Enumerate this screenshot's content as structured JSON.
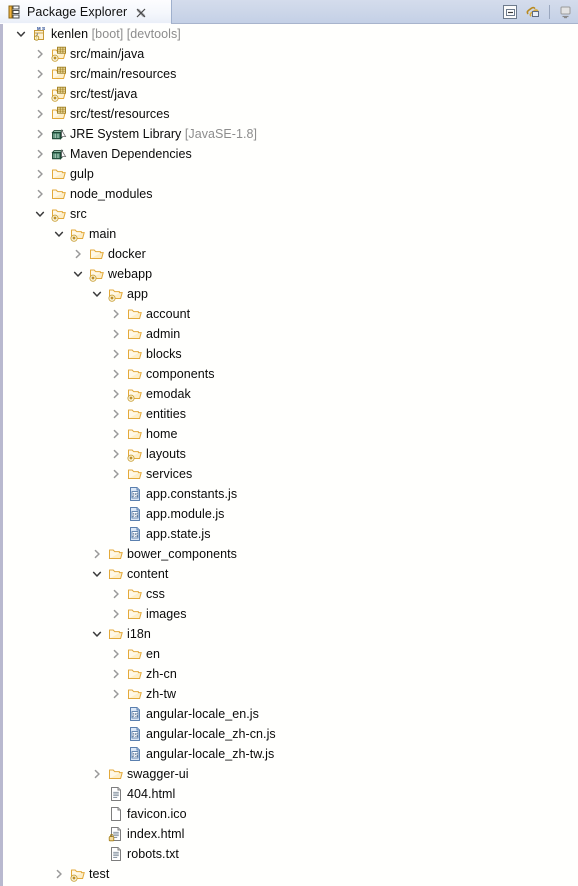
{
  "view": {
    "title": "Package Explorer",
    "tab_icon": "package-explorer-icon",
    "close_label": "╳",
    "toolbar": [
      {
        "name": "collapse-all-button",
        "label": "Collapse All"
      },
      {
        "name": "link-with-editor-button",
        "label": "Link with Editor"
      },
      {
        "name": "view-menu-button",
        "label": "View Menu"
      }
    ]
  },
  "tree": {
    "rows": [
      {
        "depth": 0,
        "twisty": "expanded",
        "icon": "java-project-icon",
        "label": "kenlen",
        "decor": " [boot] [devtools]"
      },
      {
        "depth": 1,
        "twisty": "collapsed",
        "icon": "source-folder-icon",
        "label": "src/main/java",
        "decor": ""
      },
      {
        "depth": 1,
        "twisty": "collapsed",
        "icon": "package-folder-icon",
        "label": "src/main/resources",
        "decor": ""
      },
      {
        "depth": 1,
        "twisty": "collapsed",
        "icon": "source-folder-icon",
        "label": "src/test/java",
        "decor": ""
      },
      {
        "depth": 1,
        "twisty": "collapsed",
        "icon": "package-folder-icon",
        "label": "src/test/resources",
        "decor": ""
      },
      {
        "depth": 1,
        "twisty": "collapsed",
        "icon": "library-icon",
        "label": "JRE System Library",
        "decor": " [JavaSE-1.8]"
      },
      {
        "depth": 1,
        "twisty": "collapsed",
        "icon": "library-icon",
        "label": "Maven Dependencies",
        "decor": ""
      },
      {
        "depth": 1,
        "twisty": "collapsed",
        "icon": "folder-icon",
        "label": "gulp",
        "decor": ""
      },
      {
        "depth": 1,
        "twisty": "collapsed",
        "icon": "folder-icon",
        "label": "node_modules",
        "decor": ""
      },
      {
        "depth": 1,
        "twisty": "expanded",
        "icon": "folder-modified-icon",
        "label": "src",
        "decor": ""
      },
      {
        "depth": 2,
        "twisty": "expanded",
        "icon": "folder-modified-icon",
        "label": "main",
        "decor": ""
      },
      {
        "depth": 3,
        "twisty": "collapsed",
        "icon": "folder-icon",
        "label": "docker",
        "decor": ""
      },
      {
        "depth": 3,
        "twisty": "expanded",
        "icon": "folder-modified-icon",
        "label": "webapp",
        "decor": ""
      },
      {
        "depth": 4,
        "twisty": "expanded",
        "icon": "folder-modified-icon",
        "label": "app",
        "decor": ""
      },
      {
        "depth": 5,
        "twisty": "collapsed",
        "icon": "folder-icon",
        "label": "account",
        "decor": ""
      },
      {
        "depth": 5,
        "twisty": "collapsed",
        "icon": "folder-icon",
        "label": "admin",
        "decor": ""
      },
      {
        "depth": 5,
        "twisty": "collapsed",
        "icon": "folder-icon",
        "label": "blocks",
        "decor": ""
      },
      {
        "depth": 5,
        "twisty": "collapsed",
        "icon": "folder-icon",
        "label": "components",
        "decor": ""
      },
      {
        "depth": 5,
        "twisty": "collapsed",
        "icon": "folder-modified-icon",
        "label": "emodak",
        "decor": ""
      },
      {
        "depth": 5,
        "twisty": "collapsed",
        "icon": "folder-icon",
        "label": "entities",
        "decor": ""
      },
      {
        "depth": 5,
        "twisty": "collapsed",
        "icon": "folder-icon",
        "label": "home",
        "decor": ""
      },
      {
        "depth": 5,
        "twisty": "collapsed",
        "icon": "folder-modified-icon",
        "label": "layouts",
        "decor": ""
      },
      {
        "depth": 5,
        "twisty": "collapsed",
        "icon": "folder-icon",
        "label": "services",
        "decor": ""
      },
      {
        "depth": 5,
        "twisty": "none",
        "icon": "js-file-icon",
        "label": "app.constants.js",
        "decor": ""
      },
      {
        "depth": 5,
        "twisty": "none",
        "icon": "js-file-icon",
        "label": "app.module.js",
        "decor": ""
      },
      {
        "depth": 5,
        "twisty": "none",
        "icon": "js-file-icon",
        "label": "app.state.js",
        "decor": ""
      },
      {
        "depth": 4,
        "twisty": "collapsed",
        "icon": "folder-icon",
        "label": "bower_components",
        "decor": ""
      },
      {
        "depth": 4,
        "twisty": "expanded",
        "icon": "folder-icon",
        "label": "content",
        "decor": ""
      },
      {
        "depth": 5,
        "twisty": "collapsed",
        "icon": "folder-icon",
        "label": "css",
        "decor": ""
      },
      {
        "depth": 5,
        "twisty": "collapsed",
        "icon": "folder-icon",
        "label": "images",
        "decor": ""
      },
      {
        "depth": 4,
        "twisty": "expanded",
        "icon": "folder-icon",
        "label": "i18n",
        "decor": ""
      },
      {
        "depth": 5,
        "twisty": "collapsed",
        "icon": "folder-icon",
        "label": "en",
        "decor": ""
      },
      {
        "depth": 5,
        "twisty": "collapsed",
        "icon": "folder-icon",
        "label": "zh-cn",
        "decor": ""
      },
      {
        "depth": 5,
        "twisty": "collapsed",
        "icon": "folder-icon",
        "label": "zh-tw",
        "decor": ""
      },
      {
        "depth": 5,
        "twisty": "none",
        "icon": "js-file-icon",
        "label": "angular-locale_en.js",
        "decor": ""
      },
      {
        "depth": 5,
        "twisty": "none",
        "icon": "js-file-icon",
        "label": "angular-locale_zh-cn.js",
        "decor": ""
      },
      {
        "depth": 5,
        "twisty": "none",
        "icon": "js-file-icon",
        "label": "angular-locale_zh-tw.js",
        "decor": ""
      },
      {
        "depth": 4,
        "twisty": "collapsed",
        "icon": "folder-icon",
        "label": "swagger-ui",
        "decor": ""
      },
      {
        "depth": 4,
        "twisty": "none",
        "icon": "html-file-icon",
        "label": "404.html",
        "decor": ""
      },
      {
        "depth": 4,
        "twisty": "none",
        "icon": "blank-file-icon",
        "label": "favicon.ico",
        "decor": ""
      },
      {
        "depth": 4,
        "twisty": "none",
        "icon": "html-file-locked-icon",
        "label": "index.html",
        "decor": ""
      },
      {
        "depth": 4,
        "twisty": "none",
        "icon": "text-file-icon",
        "label": "robots.txt",
        "decor": ""
      },
      {
        "depth": 2,
        "twisty": "collapsed",
        "icon": "folder-modified-icon",
        "label": "test",
        "decor": ""
      }
    ]
  },
  "colors": {
    "tab_bar": "#cdd7e9",
    "folder": "#f0b03c",
    "folder_fill": "#fde9c0",
    "library": "#2d6b52",
    "decor_text": "#8d8d8d",
    "js_file": "#5a86c0",
    "tree_bg": "#fffffd"
  }
}
